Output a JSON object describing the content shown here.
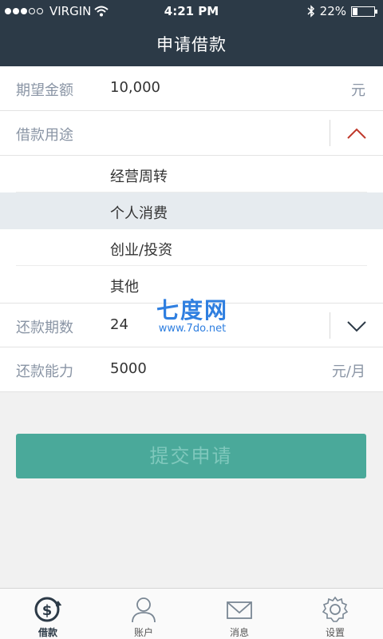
{
  "status_bar": {
    "carrier": "VIRGIN",
    "time": "4:21 PM",
    "battery": "22%",
    "battery_level": 0.22
  },
  "nav": {
    "title": "申请借款"
  },
  "form": {
    "amount": {
      "label": "期望金额",
      "value": "10,000",
      "unit": "元"
    },
    "purpose": {
      "label": "借款用途",
      "options": [
        "经营周转",
        "个人消费",
        "创业/投资",
        "其他"
      ],
      "selected": "个人消费"
    },
    "term": {
      "label": "还款期数",
      "value": "24"
    },
    "ability": {
      "label": "还款能力",
      "value": "5000",
      "unit": "元/月"
    }
  },
  "watermark": {
    "logo": "七度网",
    "url": "www.7do.net"
  },
  "submit_label": "提交申请",
  "tabs": [
    {
      "label": "借款",
      "icon": "loan-icon",
      "active": true
    },
    {
      "label": "账户",
      "icon": "user-icon",
      "active": false
    },
    {
      "label": "消息",
      "icon": "mail-icon",
      "active": false
    },
    {
      "label": "设置",
      "icon": "gear-icon",
      "active": false
    }
  ],
  "colors": {
    "header": "#2c3a47",
    "accent": "#4aa99a",
    "arrow_open": "#c0392b",
    "arrow_closed": "#2c3a47"
  }
}
